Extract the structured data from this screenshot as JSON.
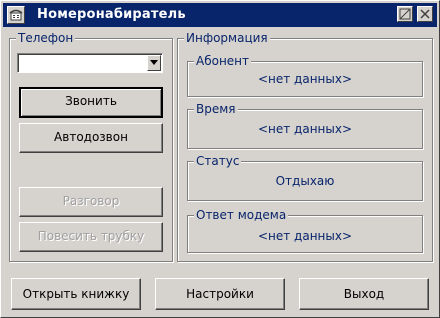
{
  "window": {
    "title": "Номеронабиратель"
  },
  "phone_group": {
    "label": "Телефон",
    "number_value": "",
    "call_button": "Звонить",
    "autodial_button": "Автодозвон",
    "talk_button": "Разговор",
    "hangup_button": "Повесить трубку"
  },
  "info_group": {
    "label": "Информация",
    "subscriber": {
      "label": "Абонент",
      "value": "<нет данных>"
    },
    "time": {
      "label": "Время",
      "value": "<нет данных>"
    },
    "status": {
      "label": "Статус",
      "value": "Отдыхаю"
    },
    "modem_reply": {
      "label": "Ответ модема",
      "value": "<нет данных>"
    }
  },
  "footer": {
    "open_book": "Открыть книжку",
    "settings": "Настройки",
    "exit": "Выход"
  },
  "colors": {
    "titlebar": "#08246b",
    "label_text": "#08246b",
    "face": "#d6d3ce"
  }
}
